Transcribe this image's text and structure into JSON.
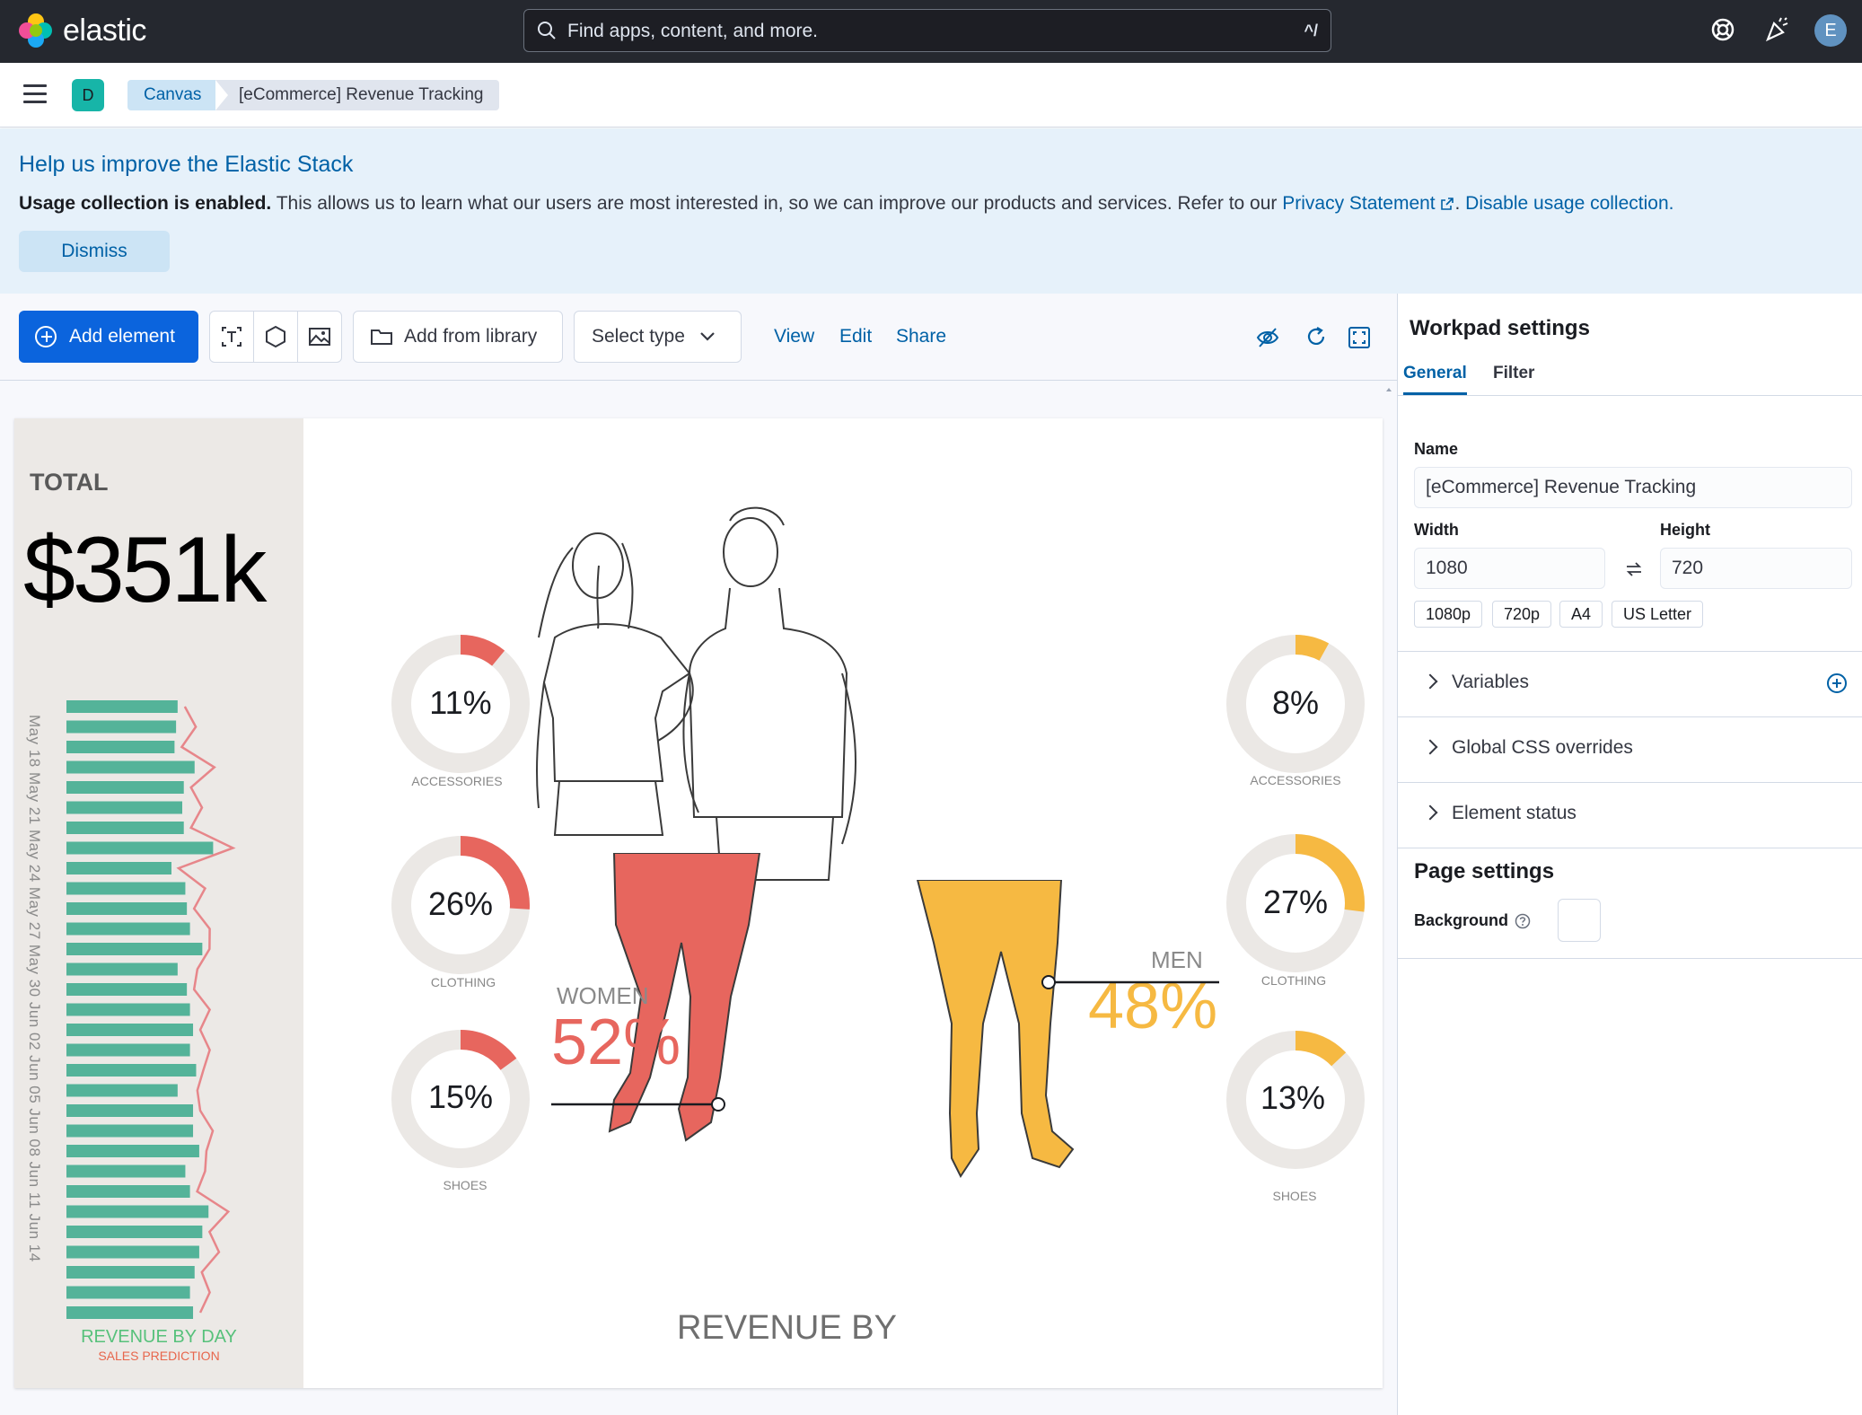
{
  "header": {
    "brand": "elastic",
    "search_placeholder": "Find apps, content, and more.",
    "search_shortcut": "^/",
    "user_initial": "E"
  },
  "breadcrumbs": {
    "space_initial": "D",
    "items": [
      "Canvas",
      "[eCommerce] Revenue Tracking"
    ]
  },
  "callout": {
    "title": "Help us improve the Elastic Stack",
    "bold": "Usage collection is enabled.",
    "text": " This allows us to learn what our users are most interested in, so we can improve our products and services. Refer to our ",
    "privacy_link": "Privacy Statement",
    "separator": ".",
    "disable_link": "Disable usage collection.",
    "dismiss_label": "Dismiss"
  },
  "toolbar": {
    "add_element": "Add element",
    "add_from_library": "Add from library",
    "select_type": "Select type",
    "links": [
      "View",
      "Edit",
      "Share"
    ]
  },
  "workpad": {
    "total_label": "TOTAL",
    "total_value": "$351k",
    "date_labels": "May 18  May 21  May 24  May 27  May 30  Jun 02  Jun 05  Jun 08  Jun 11  Jun 14",
    "revenue_by_day": "REVENUE BY DAY",
    "sales_prediction": "SALES PREDICTION",
    "revenue_by": "REVENUE BY",
    "women": {
      "label": "WOMEN",
      "pct": "52%",
      "color": "#e7665e"
    },
    "men": {
      "label": "MEN",
      "pct": "48%",
      "color": "#f6b942"
    },
    "women_categories": [
      {
        "pct": "11%",
        "label": "ACCESSORIES",
        "value": 0.11
      },
      {
        "pct": "26%",
        "label": "CLOTHING",
        "value": 0.26
      },
      {
        "pct": "15%",
        "label": "SHOES",
        "value": 0.15
      }
    ],
    "men_categories": [
      {
        "pct": "8%",
        "label": "ACCESSORIES",
        "value": 0.08
      },
      {
        "pct": "27%",
        "label": "CLOTHING",
        "value": 0.27
      },
      {
        "pct": "13%",
        "label": "SHOES",
        "value": 0.13
      }
    ],
    "daily_bars": [
      0.72,
      0.71,
      0.7,
      0.83,
      0.76,
      0.75,
      0.76,
      0.95,
      0.68,
      0.77,
      0.78,
      0.8,
      0.88,
      0.72,
      0.78,
      0.8,
      0.82,
      0.8,
      0.84,
      0.72,
      0.82,
      0.82,
      0.86,
      0.77,
      0.8,
      0.92,
      0.88,
      0.86,
      0.83,
      0.8,
      0.82
    ],
    "bar_color": "#54b399",
    "prediction_color": "#e7868a"
  },
  "sidebar": {
    "title": "Workpad settings",
    "tabs": [
      "General",
      "Filter"
    ],
    "name_label": "Name",
    "name_value": "[eCommerce] Revenue Tracking",
    "width_label": "Width",
    "width_value": "1080",
    "height_label": "Height",
    "height_value": "720",
    "presets": [
      "1080p",
      "720p",
      "A4",
      "US Letter"
    ],
    "sections": [
      "Variables",
      "Global CSS overrides",
      "Element status"
    ],
    "page_settings_title": "Page settings",
    "background_label": "Background"
  }
}
